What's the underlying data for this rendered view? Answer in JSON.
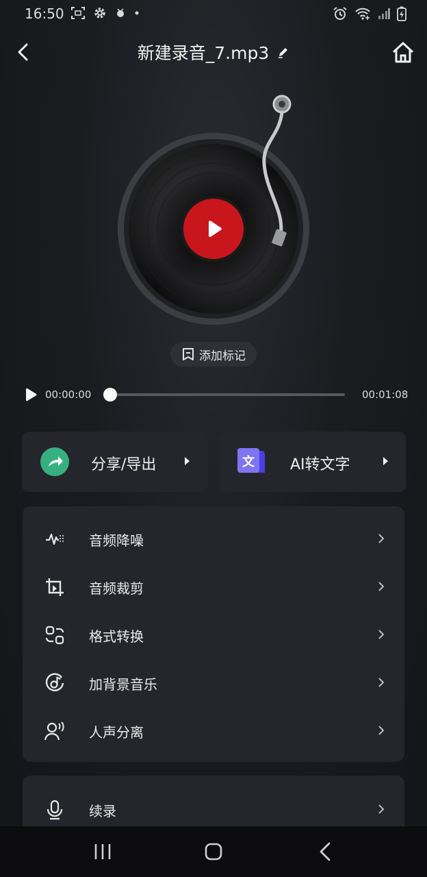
{
  "status_bar": {
    "time": "16:50",
    "left_icons": [
      "screenshot-icon",
      "gear-icon",
      "bug-icon",
      "dot-icon"
    ],
    "right_icons": [
      "alarm-icon",
      "wifi-icon",
      "signal-icon",
      "battery-icon"
    ]
  },
  "header": {
    "title": "新建录音_7.mp3",
    "back_icon": "chevron-left-icon",
    "edit_icon": "pencil-icon",
    "home_icon": "home-icon"
  },
  "player": {
    "add_mark_label": "添加标记",
    "current_time": "00:00:00",
    "total_time": "00:01:08",
    "progress": 0,
    "accent": "#c8161c"
  },
  "actions": {
    "share_label": "分享/导出",
    "ai_label": "AI转文字",
    "share_color": "#37b07f",
    "ai_color": "#5b4ef0"
  },
  "tools": [
    {
      "label": "音频降噪",
      "icon": "waveform-icon"
    },
    {
      "label": "音频裁剪",
      "icon": "crop-icon"
    },
    {
      "label": "格式转换",
      "icon": "convert-icon"
    },
    {
      "label": "加背景音乐",
      "icon": "music-disc-icon"
    },
    {
      "label": "人声分离",
      "icon": "voice-icon"
    }
  ],
  "extra_tools": [
    {
      "label": "续录",
      "icon": "microphone-icon"
    }
  ],
  "navbar": [
    "recent-apps-icon",
    "home-nav-icon",
    "back-nav-icon"
  ]
}
